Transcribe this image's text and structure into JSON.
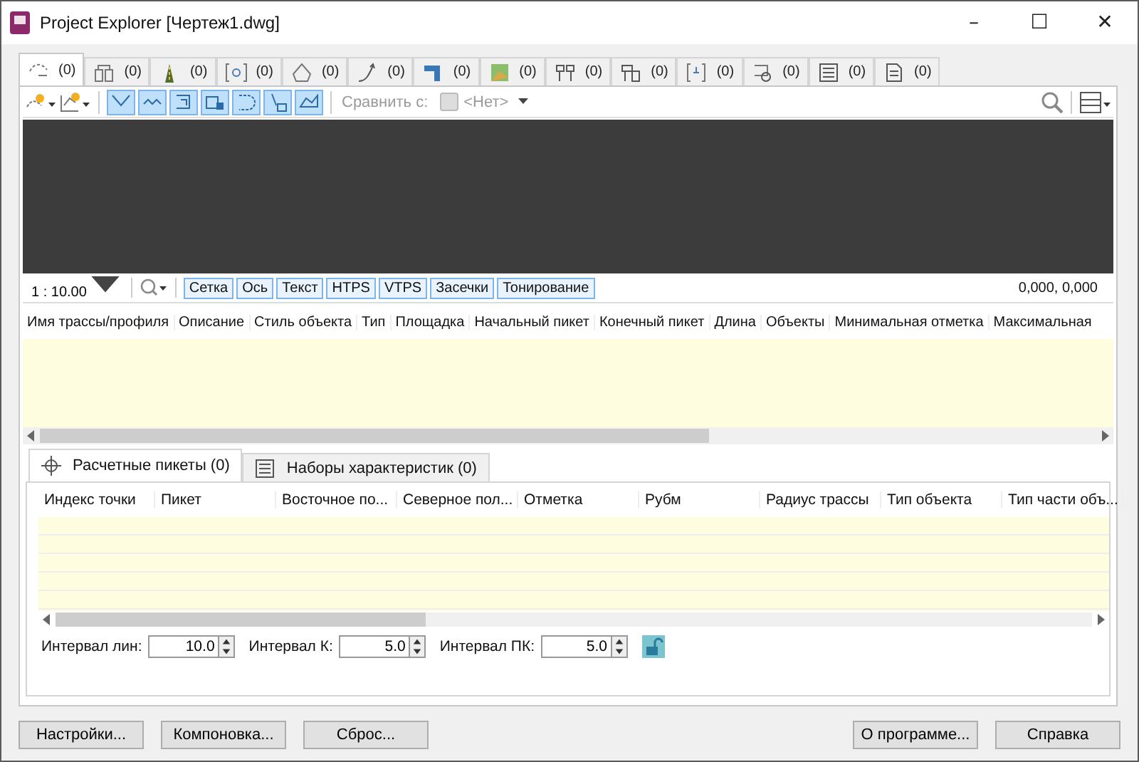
{
  "window": {
    "title": "Project Explorer [Чертеж1.dwg]",
    "controls": [
      "–",
      "☐",
      "✕"
    ]
  },
  "object_tabs": [
    {
      "count": "(0)",
      "selected": true
    },
    {
      "count": "(0)",
      "selected": false
    },
    {
      "count": "(0)",
      "selected": false
    },
    {
      "count": "(0)",
      "selected": false
    },
    {
      "count": "(0)",
      "selected": false
    },
    {
      "count": "(0)",
      "selected": false
    },
    {
      "count": "(0)",
      "selected": false
    },
    {
      "count": "(0)",
      "selected": false
    },
    {
      "count": "(0)",
      "selected": false
    },
    {
      "count": "(0)",
      "selected": false
    },
    {
      "count": "(0)",
      "selected": false
    },
    {
      "count": "(0)",
      "selected": false
    },
    {
      "count": "(0)",
      "selected": false
    },
    {
      "count": "(0)",
      "selected": false
    }
  ],
  "toolbar": {
    "toggles": [
      {
        "on": true
      },
      {
        "on": true
      },
      {
        "on": true
      },
      {
        "on": true
      },
      {
        "on": true
      },
      {
        "on": true
      },
      {
        "on": true
      }
    ],
    "compare_label": "Сравнить с:",
    "compare_value": "<Нет>"
  },
  "status_bar": {
    "scale": "1 : 10.00",
    "buttons": [
      "Сетка",
      "Ось",
      "Текст",
      "HTPS",
      "VTPS",
      "Засечки",
      "Тонирование"
    ],
    "coordinates": "0,000, 0,000"
  },
  "table": {
    "columns": [
      "Имя трассы/профиля",
      "Описание",
      "Стиль объекта",
      "Тип",
      "Площадка",
      "Начальный пикет",
      "Конечный пикет",
      "Длина",
      "Объекты",
      "Минимальная отметка",
      "Максимальная"
    ]
  },
  "lower_tabs": [
    {
      "label": "Расчетные пикеты (0)",
      "selected": true
    },
    {
      "label": "Наборы характеристик (0)",
      "selected": false
    }
  ],
  "lower_table": {
    "columns": [
      "Индекс точки",
      "Пикет",
      "Восточное по...",
      "Северное пол...",
      "Отметка",
      "Рубм",
      "Радиус трассы",
      "Тип объекта",
      "Тип части объ..."
    ]
  },
  "intervals": [
    {
      "label": "Интервал лин:",
      "value": "10.0"
    },
    {
      "label": "Интервал К:",
      "value": "5.0"
    },
    {
      "label": "Интервал ПК:",
      "value": "5.0"
    }
  ],
  "footer": {
    "left_buttons": [
      "Настройки...",
      "Компоновка...",
      "Сброс..."
    ],
    "right_buttons": [
      "О программе...",
      "Справка"
    ]
  }
}
